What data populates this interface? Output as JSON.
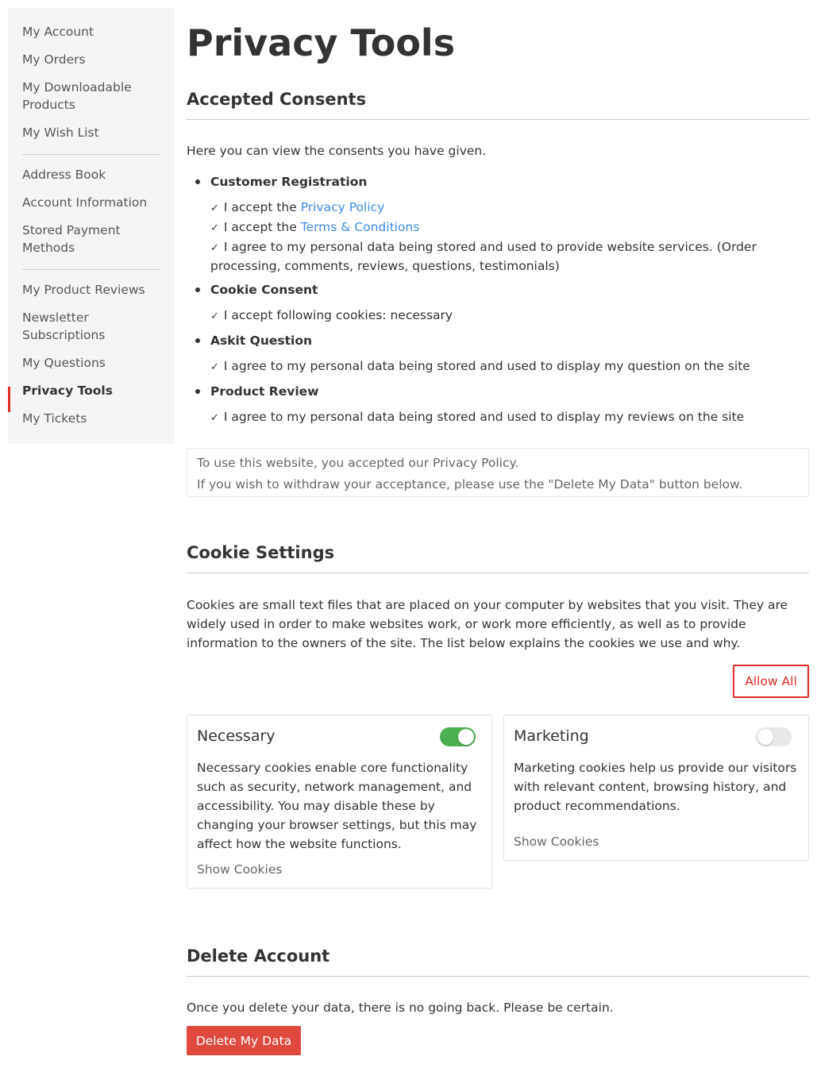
{
  "sidebar": {
    "items": [
      {
        "label": "My Account"
      },
      {
        "label": "My Orders"
      },
      {
        "label": "My Downloadable Products"
      },
      {
        "label": "My Wish List"
      },
      {
        "label": "Address Book"
      },
      {
        "label": "Account Information"
      },
      {
        "label": "Stored Payment Methods"
      },
      {
        "label": "My Product Reviews"
      },
      {
        "label": "Newsletter Subscriptions"
      },
      {
        "label": "My Questions"
      },
      {
        "label": "Privacy Tools",
        "active": true
      },
      {
        "label": "My Tickets"
      }
    ]
  },
  "page": {
    "title": "Privacy Tools"
  },
  "consents": {
    "heading": "Accepted Consents",
    "intro": "Here you can view the consents you have given.",
    "groups": [
      {
        "title": "Customer Registration",
        "lines": [
          {
            "prefix": "I accept the ",
            "link": "Privacy Policy"
          },
          {
            "prefix": "I accept the ",
            "link": "Terms & Conditions"
          },
          {
            "text": "I agree to my personal data being stored and used to provide website services. (Order processing, comments, reviews, questions, testimonials)"
          }
        ]
      },
      {
        "title": "Cookie Consent",
        "lines": [
          {
            "text": "I accept following cookies: necessary"
          }
        ]
      },
      {
        "title": "Askit Question",
        "lines": [
          {
            "text": "I agree to my personal data being stored and used to display my question on the site"
          }
        ]
      },
      {
        "title": "Product Review",
        "lines": [
          {
            "text": "I agree to my personal data being stored and used to display my reviews on the site"
          }
        ]
      }
    ],
    "check_glyph": "✓",
    "notice_line1": "To use this website, you accepted our Privacy Policy.",
    "notice_line2": "If you wish to withdraw your acceptance, please use the \"Delete My Data\" button below."
  },
  "cookies": {
    "heading": "Cookie Settings",
    "description": "Cookies are small text files that are placed on your computer by websites that you visit. They are widely used in order to make websites work, or work more efficiently, as well as to provide information to the owners of the site. The list below explains the cookies we use and why.",
    "allow_all_label": "Allow All",
    "groups": [
      {
        "title": "Necessary",
        "enabled": true,
        "description": "Necessary cookies enable core functionality such as security, network management, and accessibility. You may disable these by changing your browser settings, but this may affect how the website functions.",
        "show_label": "Show Cookies"
      },
      {
        "title": "Marketing",
        "enabled": false,
        "description": "Marketing cookies help us provide our visitors with relevant content, browsing history, and product recommendations.",
        "show_label": "Show Cookies"
      }
    ]
  },
  "delete_account": {
    "heading": "Delete Account",
    "warning": "Once you delete your data, there is no going back. Please be certain.",
    "button_label": "Delete My Data"
  },
  "colors": {
    "accent_red": "#e02b27",
    "link_blue": "#3f8be4",
    "toggle_on": "#4caf50",
    "delete_button": "#e0493d"
  }
}
